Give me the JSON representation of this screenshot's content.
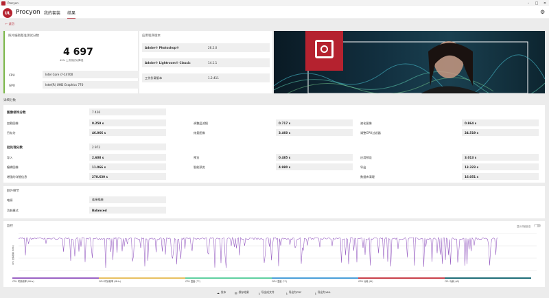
{
  "window": {
    "title": "Procyon"
  },
  "nav": {
    "brand": "Procyon",
    "logo": "UL",
    "tabs": [
      "我的套装",
      "结果"
    ]
  },
  "back": {
    "label": "返回"
  },
  "score_panel": {
    "title": "照片编辑基准测试分数",
    "score": "4 697",
    "sub": "49% 上次测试以降低",
    "cpu_label": "CPU",
    "cpu_value": "Intel Core i7-14700",
    "gpu_label": "GPU",
    "gpu_value": "Intel(R) UHD Graphics 770"
  },
  "apps_panel": {
    "title": "应用程序版本",
    "rows": [
      {
        "name": "Adobe® Photoshop®",
        "version": "26.2.0"
      },
      {
        "name": "Adobe® Lightroom® Classic",
        "version": "14.1.1"
      },
      {
        "name": "工作负载版本",
        "version": "1.2.411"
      }
    ]
  },
  "details": {
    "title": "详细分数",
    "image_title": "图像修饰分数",
    "image_score": "7 426",
    "image_rows": [
      [
        {
          "label": "加载图像",
          "value": "0.259 s"
        },
        {
          "label": "调整层滤镜",
          "value": "0.717 s"
        },
        {
          "label": "液化图像",
          "value": "0.864 s"
        }
      ],
      [
        {
          "label": "另存为",
          "value": "46.066 s"
        },
        {
          "label": "修复图像",
          "value": "3.460 s"
        },
        {
          "label": "调整GPU过滤器",
          "value": "24.519 s"
        }
      ]
    ],
    "batch_title": "批处理分数",
    "batch_score": "2 972",
    "batch_rows": [
      [
        {
          "label": "导入",
          "value": "2.608 s"
        },
        {
          "label": "预览",
          "value": "0.485 s"
        },
        {
          "label": "应用预设",
          "value": "3.013 s"
        }
      ],
      [
        {
          "label": "编辑图像",
          "value": "11.066 s"
        },
        {
          "label": "智能预览",
          "value": "4.980 s"
        },
        {
          "label": "导出",
          "value": "13.323 s"
        }
      ],
      [
        {
          "label": "增强的详细信息",
          "value": "278.630 s"
        },
        {
          "label": "",
          "value": ""
        },
        {
          "label": "数据库清理",
          "value": "16.051 s"
        }
      ]
    ]
  },
  "extra": {
    "title": "额外细节",
    "rows": [
      {
        "label": "电源",
        "value": "连接插座"
      },
      {
        "label": "功耗模式",
        "value": "Balanced"
      }
    ]
  },
  "monitor": {
    "title": "监控",
    "toggle_label": "显示详细信息",
    "y_label": "CPU 时钟频率 (MHz)",
    "legend": [
      {
        "name": "CPU 时钟频率 (MHz)",
        "color": "#9a62c4"
      },
      {
        "name": "GPU 时钟频率 (MHz)",
        "color": "#e8c060"
      },
      {
        "name": "CPU 温度 (°C)",
        "color": "#5fd0a0"
      },
      {
        "name": "GPU 温度 (°C)",
        "color": "#4a9fd8"
      },
      {
        "name": "GPU 功耗 (W)",
        "color": "#c8404a"
      },
      {
        "name": "CPU 功耗 (W)",
        "color": "#1e6e78"
      }
    ]
  },
  "footer": [
    "发布",
    "保存结果",
    "导出成文件",
    "导出为PDF",
    "导出为XML"
  ]
}
